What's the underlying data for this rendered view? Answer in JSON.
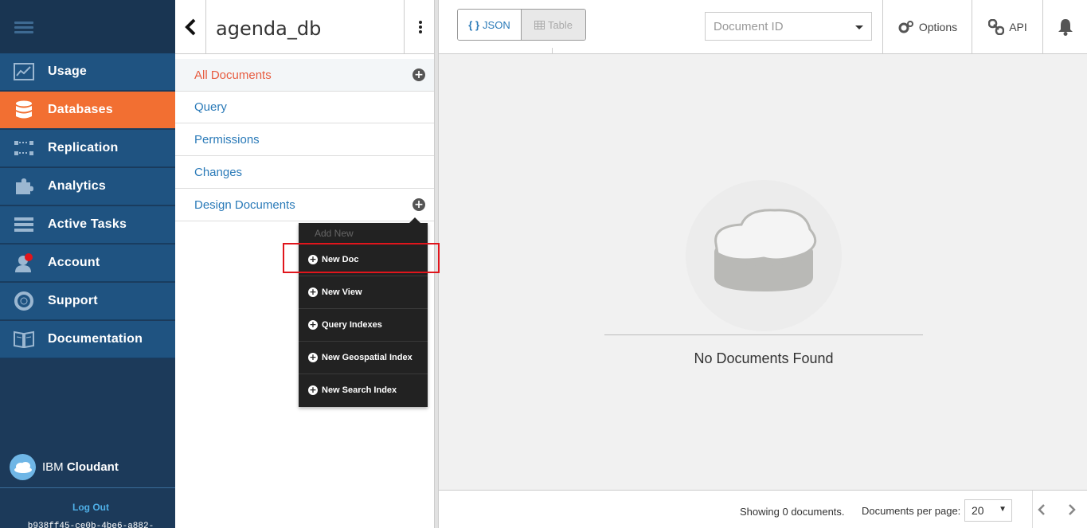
{
  "nav": {
    "items": [
      {
        "label": "Usage",
        "icon": "usage-chart-icon"
      },
      {
        "label": "Databases",
        "icon": "database-icon"
      },
      {
        "label": "Replication",
        "icon": "replication-icon"
      },
      {
        "label": "Analytics",
        "icon": "puzzle-icon"
      },
      {
        "label": "Active Tasks",
        "icon": "tasks-icon"
      },
      {
        "label": "Account",
        "icon": "account-icon"
      },
      {
        "label": "Support",
        "icon": "lifebuoy-icon"
      },
      {
        "label": "Documentation",
        "icon": "book-icon"
      }
    ],
    "active_index": 1,
    "brand_prefix": "IBM",
    "brand_name": "Cloudant",
    "logout": "Log Out",
    "user_id": "b938ff45-ce0b-4be6-a882-"
  },
  "sidebar": {
    "db_name": "agenda_db",
    "items": [
      {
        "label": "All Documents"
      },
      {
        "label": "Query"
      },
      {
        "label": "Permissions"
      },
      {
        "label": "Changes"
      },
      {
        "label": "Design Documents"
      }
    ]
  },
  "menu": {
    "header": "Add New",
    "items": [
      {
        "label": "New Doc"
      },
      {
        "label": "New View"
      },
      {
        "label": "Query Indexes"
      },
      {
        "label": "New Geospatial Index"
      },
      {
        "label": "New Search Index"
      }
    ]
  },
  "toolbar": {
    "json_label": "JSON",
    "json_glyph": "{ }",
    "table_label": "Table",
    "docid_placeholder": "Document ID",
    "options_label": "Options",
    "api_label": "API"
  },
  "content": {
    "empty_message": "No Documents Found"
  },
  "footer": {
    "showing": "Showing 0 documents.",
    "per_page_label": "Documents per page:",
    "per_page_value": "20"
  },
  "colors": {
    "nav_bg": "#1f5381",
    "nav_active": "#f26f32",
    "link": "#2a7ab8",
    "active_link": "#e75b3f",
    "highlight": "#e0151c"
  }
}
